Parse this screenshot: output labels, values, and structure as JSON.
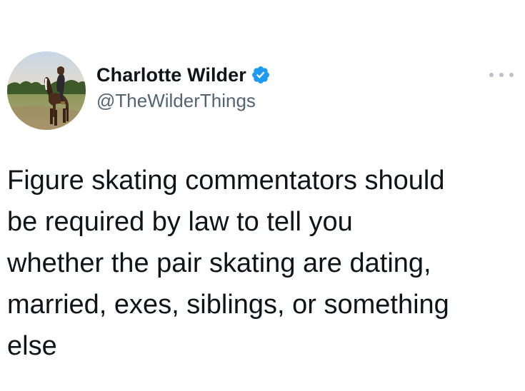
{
  "author": {
    "display_name": "Charlotte Wilder",
    "handle": "@TheWilderThings",
    "verified_icon": "verified-badge-icon",
    "avatar": "profile-photo-rider-on-horse"
  },
  "tweet": {
    "text": "Figure skating commentators should\nbe required by law to tell you\nwhether the pair skating are dating,\nmarried, exes, siblings, or something\nelse"
  },
  "more_icon": "more-options-icon",
  "colors": {
    "text": "#0f1419",
    "handle": "#536471",
    "verified": "#1d9bf0",
    "more": "#b9c2c9"
  }
}
